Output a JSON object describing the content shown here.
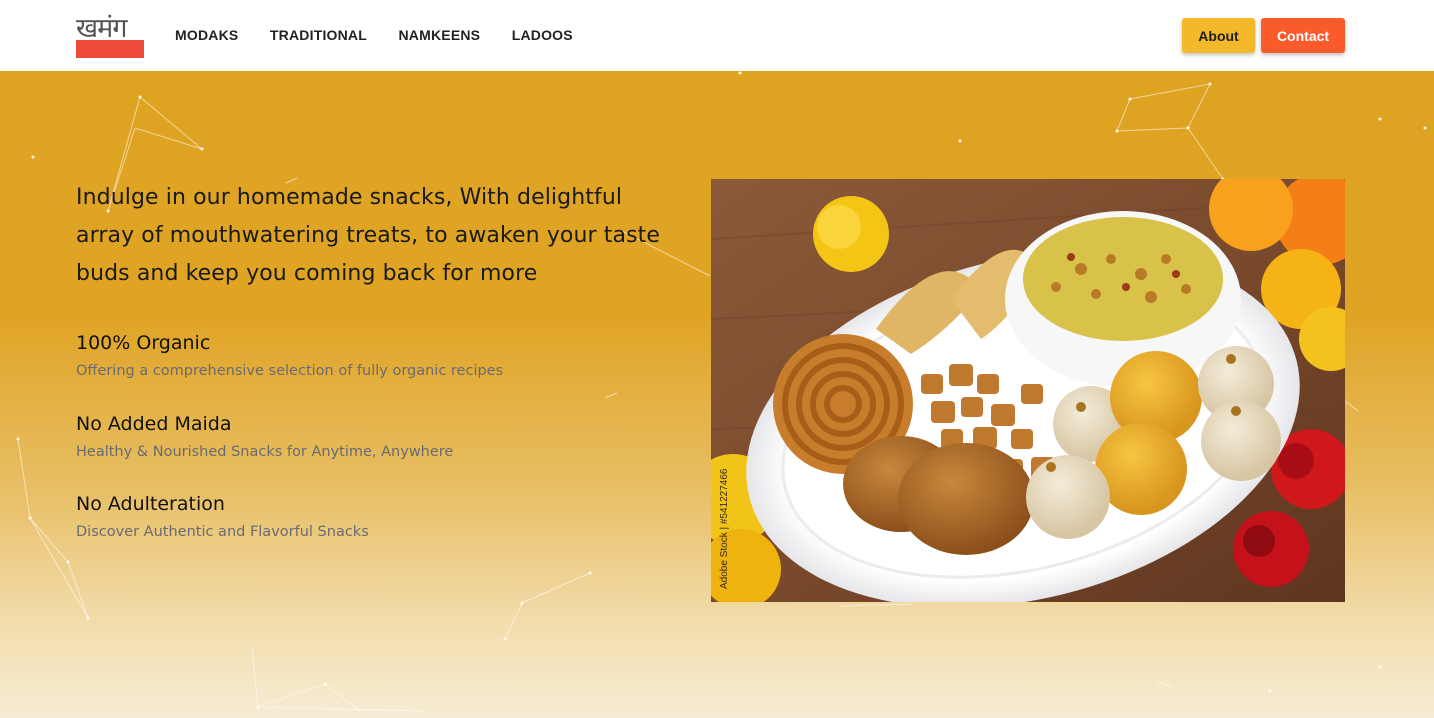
{
  "brand": {
    "logo_text": "खमंग",
    "logo_color": "#ef4a37"
  },
  "nav": {
    "links": [
      {
        "label": "MODAKS"
      },
      {
        "label": "TRADITIONAL"
      },
      {
        "label": "NAMKEENS"
      },
      {
        "label": "LADOOS"
      }
    ],
    "about_label": "About",
    "contact_label": "Contact",
    "about_color": "#f4b92b",
    "contact_color": "#fb5a2b"
  },
  "hero": {
    "tagline": "Indulge in our homemade snacks, With delightful array of mouthwatering treats, to awaken your taste buds and keep you coming back for more",
    "features": [
      {
        "title": "100% Organic",
        "description": "Offering a comprehensive selection of fully organic recipes"
      },
      {
        "title": "No Added Maida",
        "description": "Healthy & Nourished Snacks for Anytime, Anywhere"
      },
      {
        "title": "No Adulteration",
        "description": "Discover Authentic and Flavorful Snacks"
      }
    ],
    "image_credit": "Adobe Stock | #541227466",
    "background_color": "#dfa322"
  }
}
